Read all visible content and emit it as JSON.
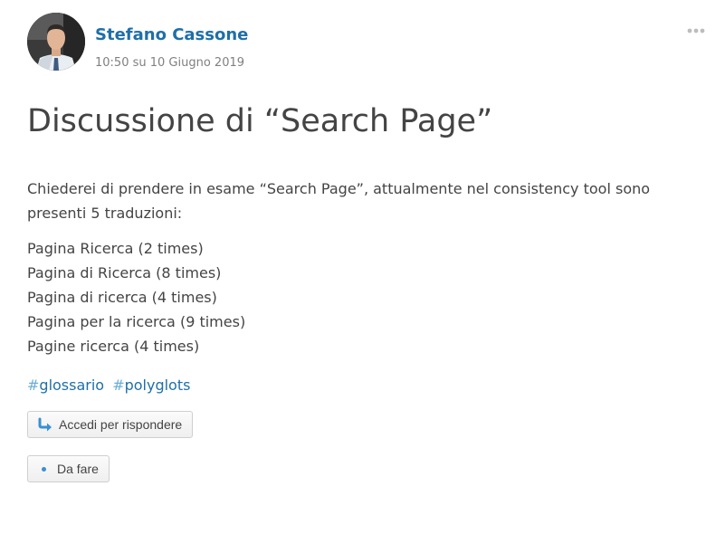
{
  "post": {
    "author": "Stefano Cassone",
    "timestamp": "10:50 su 10 Giugno 2019",
    "title": "Discussione di “Search Page”",
    "intro": "Chiederei di prendere in esame “Search Page”, attualmente nel consistency tool sono presenti 5 traduzioni:",
    "translations": [
      "Pagina Ricerca (2 times)",
      "Pagina di Ricerca (8 times)",
      "Pagina di ricerca (4 times)",
      "Pagina per la ricerca (9 times)",
      "Pagine ricerca (4 times)"
    ],
    "tags": [
      {
        "hash": "#",
        "label": "glossario"
      },
      {
        "hash": "#",
        "label": "polyglots"
      }
    ]
  },
  "actions": {
    "reply_label": "Accedi per rispondere",
    "todo_label": "Da fare"
  },
  "icons": {
    "more": "more-options-icon",
    "reply": "reply-arrow-icon",
    "status": "dot-icon"
  },
  "colors": {
    "author_link": "#1f6fa8",
    "tag_link": "#1f6fa8",
    "tag_hash": "#6aaed6",
    "text": "#444444",
    "muted": "#808080"
  }
}
